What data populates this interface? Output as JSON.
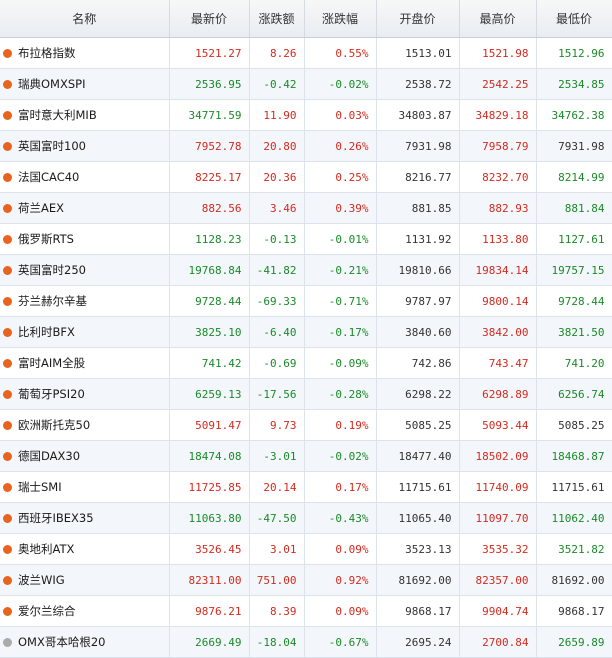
{
  "headers": [
    "名称",
    "最新价",
    "涨跌额",
    "涨跌幅",
    "开盘价",
    "最高价",
    "最低价"
  ],
  "colors": {
    "up": "#d42a1e",
    "down": "#1a8a28",
    "flat": "#333333",
    "dot_active": "#e8641e",
    "dot_inactive": "#aaaaaa"
  },
  "rows": [
    {
      "name": "布拉格指数",
      "dot": "active",
      "last": "1521.27",
      "change": "8.26",
      "pct": "0.55%",
      "open": "1513.01",
      "high": "1521.98",
      "low": "1512.96"
    },
    {
      "name": "瑞典OMXSPI",
      "dot": "active",
      "last": "2536.95",
      "change": "-0.42",
      "pct": "-0.02%",
      "open": "2538.72",
      "high": "2542.25",
      "low": "2534.85"
    },
    {
      "name": "富时意大利MIB",
      "dot": "active",
      "last": "34771.59",
      "change": "11.90",
      "pct": "0.03%",
      "open": "34803.87",
      "high": "34829.18",
      "low": "34762.38"
    },
    {
      "name": "英国富时100",
      "dot": "active",
      "last": "7952.78",
      "change": "20.80",
      "pct": "0.26%",
      "open": "7931.98",
      "high": "7958.79",
      "low": "7931.98"
    },
    {
      "name": "法国CAC40",
      "dot": "active",
      "last": "8225.17",
      "change": "20.36",
      "pct": "0.25%",
      "open": "8216.77",
      "high": "8232.70",
      "low": "8214.99"
    },
    {
      "name": "荷兰AEX",
      "dot": "active",
      "last": "882.56",
      "change": "3.46",
      "pct": "0.39%",
      "open": "881.85",
      "high": "882.93",
      "low": "881.84"
    },
    {
      "name": "俄罗斯RTS",
      "dot": "active",
      "last": "1128.23",
      "change": "-0.13",
      "pct": "-0.01%",
      "open": "1131.92",
      "high": "1133.80",
      "low": "1127.61"
    },
    {
      "name": "英国富时250",
      "dot": "active",
      "last": "19768.84",
      "change": "-41.82",
      "pct": "-0.21%",
      "open": "19810.66",
      "high": "19834.14",
      "low": "19757.15"
    },
    {
      "name": "芬兰赫尔辛基",
      "dot": "active",
      "last": "9728.44",
      "change": "-69.33",
      "pct": "-0.71%",
      "open": "9787.97",
      "high": "9800.14",
      "low": "9728.44"
    },
    {
      "name": "比利时BFX",
      "dot": "active",
      "last": "3825.10",
      "change": "-6.40",
      "pct": "-0.17%",
      "open": "3840.60",
      "high": "3842.00",
      "low": "3821.50"
    },
    {
      "name": "富时AIM全股",
      "dot": "active",
      "last": "741.42",
      "change": "-0.69",
      "pct": "-0.09%",
      "open": "742.86",
      "high": "743.47",
      "low": "741.20"
    },
    {
      "name": "葡萄牙PSI20",
      "dot": "active",
      "last": "6259.13",
      "change": "-17.56",
      "pct": "-0.28%",
      "open": "6298.22",
      "high": "6298.89",
      "low": "6256.74"
    },
    {
      "name": "欧洲斯托克50",
      "dot": "active",
      "last": "5091.47",
      "change": "9.73",
      "pct": "0.19%",
      "open": "5085.25",
      "high": "5093.44",
      "low": "5085.25"
    },
    {
      "name": "德国DAX30",
      "dot": "active",
      "last": "18474.08",
      "change": "-3.01",
      "pct": "-0.02%",
      "open": "18477.40",
      "high": "18502.09",
      "low": "18468.87"
    },
    {
      "name": "瑞士SMI",
      "dot": "active",
      "last": "11725.85",
      "change": "20.14",
      "pct": "0.17%",
      "open": "11715.61",
      "high": "11740.09",
      "low": "11715.61"
    },
    {
      "name": "西班牙IBEX35",
      "dot": "active",
      "last": "11063.80",
      "change": "-47.50",
      "pct": "-0.43%",
      "open": "11065.40",
      "high": "11097.70",
      "low": "11062.40"
    },
    {
      "name": "奥地利ATX",
      "dot": "active",
      "last": "3526.45",
      "change": "3.01",
      "pct": "0.09%",
      "open": "3523.13",
      "high": "3535.32",
      "low": "3521.82"
    },
    {
      "name": "波兰WIG",
      "dot": "active",
      "last": "82311.00",
      "change": "751.00",
      "pct": "0.92%",
      "open": "81692.00",
      "high": "82357.00",
      "low": "81692.00"
    },
    {
      "name": "爱尔兰综合",
      "dot": "active",
      "last": "9876.21",
      "change": "8.39",
      "pct": "0.09%",
      "open": "9868.17",
      "high": "9904.74",
      "low": "9868.17"
    },
    {
      "name": "OMX哥本哈根20",
      "dot": "inactive",
      "last": "2669.49",
      "change": "-18.04",
      "pct": "-0.67%",
      "open": "2695.24",
      "high": "2700.84",
      "low": "2659.89"
    }
  ]
}
